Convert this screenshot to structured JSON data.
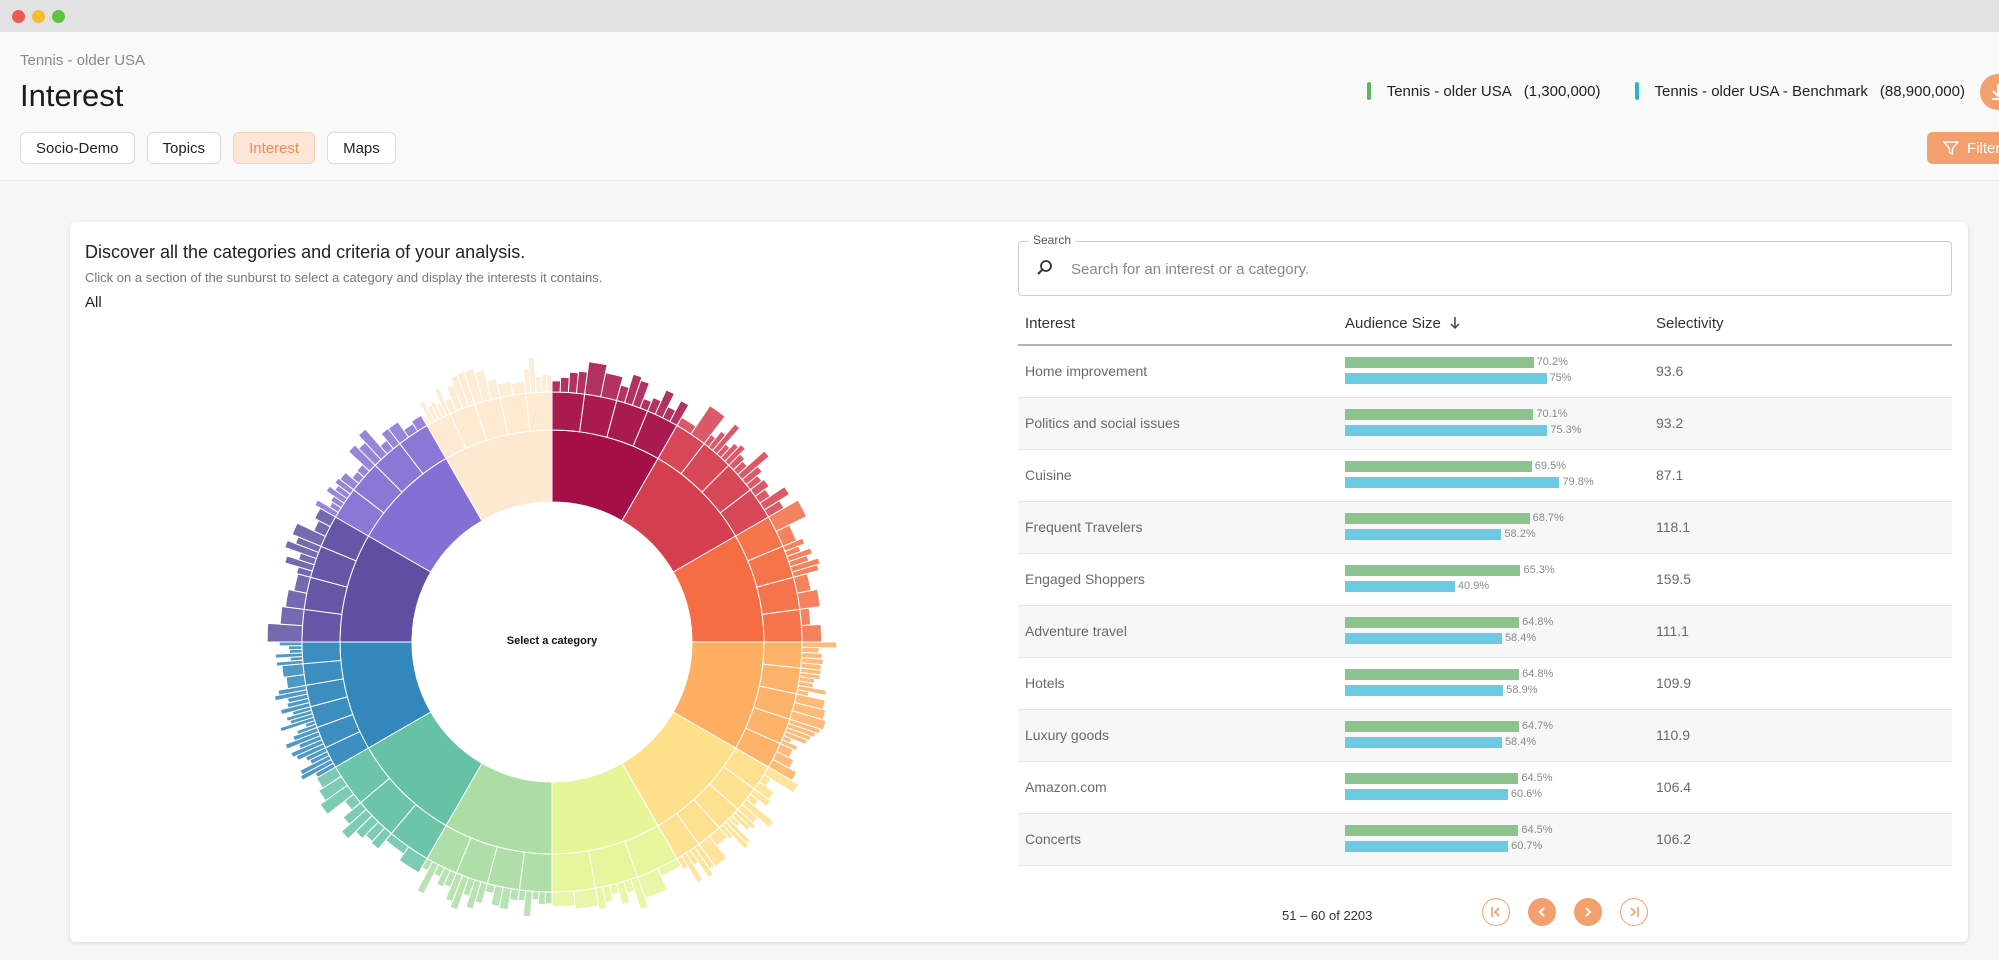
{
  "breadcrumb": "Tennis - older USA",
  "page_title": "Interest",
  "tabs": [
    {
      "label": "Socio-Demo",
      "active": false
    },
    {
      "label": "Topics",
      "active": false
    },
    {
      "label": "Interest",
      "active": true
    },
    {
      "label": "Maps",
      "active": false
    }
  ],
  "audiences": [
    {
      "name": "Tennis - older USA",
      "count": "(1,300,000)",
      "color": "#5cb85c"
    },
    {
      "name": "Tennis - older USA - Benchmark",
      "count": "(88,900,000)",
      "color": "#2ab3c9"
    }
  ],
  "download_icon": "download-icon",
  "filter_label": "Filter",
  "card": {
    "title": "Discover all the categories and criteria of your analysis.",
    "subtitle": "Click on a section of the sunburst to select a category and display the interests it contains.",
    "crumb": "All",
    "center_label": "Select a category"
  },
  "search": {
    "label": "Search",
    "placeholder": "Search for an interest or a category."
  },
  "table": {
    "headers": [
      "Interest",
      "Audience Size",
      "Selectivity"
    ],
    "sort_icon": "arrow-down-icon",
    "rows": [
      {
        "name": "Home improvement",
        "target": "70.2%",
        "target_value": 70.2,
        "bench": "75%",
        "bench_value": 75.0,
        "selectivity": "93.6"
      },
      {
        "name": "Politics and social issues",
        "target": "70.1%",
        "target_value": 70.1,
        "bench": "75.3%",
        "bench_value": 75.3,
        "selectivity": "93.2"
      },
      {
        "name": "Cuisine",
        "target": "69.5%",
        "target_value": 69.5,
        "bench": "79.8%",
        "bench_value": 79.8,
        "selectivity": "87.1"
      },
      {
        "name": "Frequent Travelers",
        "target": "68.7%",
        "target_value": 68.7,
        "bench": "58.2%",
        "bench_value": 58.2,
        "selectivity": "118.1"
      },
      {
        "name": "Engaged Shoppers",
        "target": "65.3%",
        "target_value": 65.3,
        "bench": "40.9%",
        "bench_value": 40.9,
        "selectivity": "159.5"
      },
      {
        "name": "Adventure travel",
        "target": "64.8%",
        "target_value": 64.8,
        "bench": "58.4%",
        "bench_value": 58.4,
        "selectivity": "111.1"
      },
      {
        "name": "Hotels",
        "target": "64.8%",
        "target_value": 64.8,
        "bench": "58.9%",
        "bench_value": 58.9,
        "selectivity": "109.9"
      },
      {
        "name": "Luxury goods",
        "target": "64.7%",
        "target_value": 64.7,
        "bench": "58.4%",
        "bench_value": 58.4,
        "selectivity": "110.9"
      },
      {
        "name": "Amazon.com",
        "target": "64.5%",
        "target_value": 64.5,
        "bench": "60.6%",
        "bench_value": 60.6,
        "selectivity": "106.4"
      },
      {
        "name": "Concerts",
        "target": "64.5%",
        "target_value": 64.5,
        "bench": "60.7%",
        "bench_value": 60.7,
        "selectivity": "106.2"
      }
    ]
  },
  "pagination": {
    "range": "51 – 60 of 2203",
    "icons": [
      "first-page-icon",
      "prev-page-icon",
      "next-page-icon",
      "last-page-icon"
    ]
  },
  "sunburst_colors": [
    "#a50f47",
    "#d53e4f",
    "#f46d43",
    "#fdae61",
    "#fee08b",
    "#e6f598",
    "#abdda4",
    "#66c2a5",
    "#3288bd",
    "#5e4fa2",
    "#8470d4",
    "#fde9cf"
  ]
}
